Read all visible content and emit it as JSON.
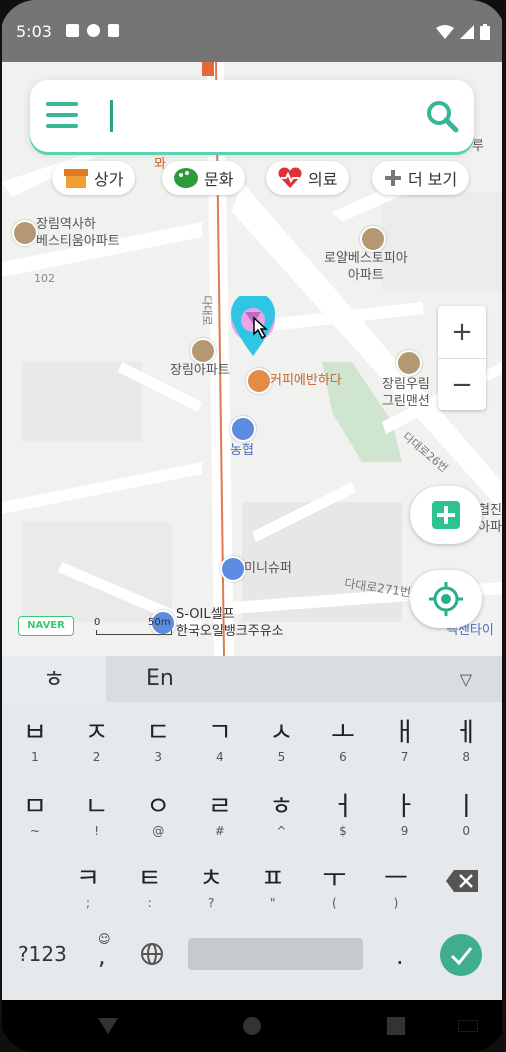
{
  "status": {
    "time": "5:03"
  },
  "search": {
    "value": ""
  },
  "chips": [
    {
      "label": "상가",
      "icon": "shop-icon"
    },
    {
      "label": "문화",
      "icon": "palette-icon"
    },
    {
      "label": "의료",
      "icon": "heart-pulse-icon"
    },
    {
      "label": "더 보기",
      "icon": "plus-icon"
    }
  ],
  "map": {
    "labels": {
      "jangrim_station": "장림역사하\n베스티움아파트",
      "num_102": "102",
      "royal": "로얄베스토피아\n아파트",
      "jangrim_apt": "장림아파트",
      "coffee": "커피에반하다",
      "jangrim_woorim": "장림우림\n그린맨션",
      "nonghyup": "농협",
      "road_26": "다대로26번",
      "mini_super": "미니슈퍼",
      "road_271": "다대로271번",
      "soil": "S-OIL셀프\n한국오일뱅크주유소",
      "road_main": "다대로",
      "right_edge_1": "협진\n아파",
      "right_edge_2": "넥센타이",
      "top_right": "루",
      "left_top": "뫄"
    },
    "scale": {
      "zero": "0",
      "distance": "50m"
    },
    "logo": "NAVER",
    "zoom": {
      "plus": "+",
      "minus": "−"
    }
  },
  "keyboard": {
    "top": {
      "hangul_key": "ㅎ",
      "lang": "En"
    },
    "row1": [
      {
        "m": "ㅂ",
        "s": "1"
      },
      {
        "m": "ㅈ",
        "s": "2"
      },
      {
        "m": "ㄷ",
        "s": "3"
      },
      {
        "m": "ㄱ",
        "s": "4"
      },
      {
        "m": "ㅅ",
        "s": "5"
      },
      {
        "m": "ㅗ",
        "s": "6"
      },
      {
        "m": "ㅐ",
        "s": "7"
      },
      {
        "m": "ㅔ",
        "s": "8"
      }
    ],
    "row2": [
      {
        "m": "ㅁ",
        "s": "~"
      },
      {
        "m": "ㄴ",
        "s": "!"
      },
      {
        "m": "ㅇ",
        "s": "@"
      },
      {
        "m": "ㄹ",
        "s": "#"
      },
      {
        "m": "ㅎ",
        "s": "^"
      },
      {
        "m": "ㅓ",
        "s": "$"
      },
      {
        "m": "ㅏ",
        "s": "9"
      },
      {
        "m": "ㅣ",
        "s": "0"
      }
    ],
    "row3": [
      {
        "m": "ㅋ",
        "s": ";"
      },
      {
        "m": "ㅌ",
        "s": ":"
      },
      {
        "m": "ㅊ",
        "s": "?"
      },
      {
        "m": "ㅍ",
        "s": "\""
      },
      {
        "m": "ㅜ",
        "s": "("
      },
      {
        "m": "ㅡ",
        "s": ")"
      }
    ],
    "bottom": {
      "sym": "?123",
      "comma": ",",
      "emoji_hint": "☺",
      "period": "."
    }
  }
}
